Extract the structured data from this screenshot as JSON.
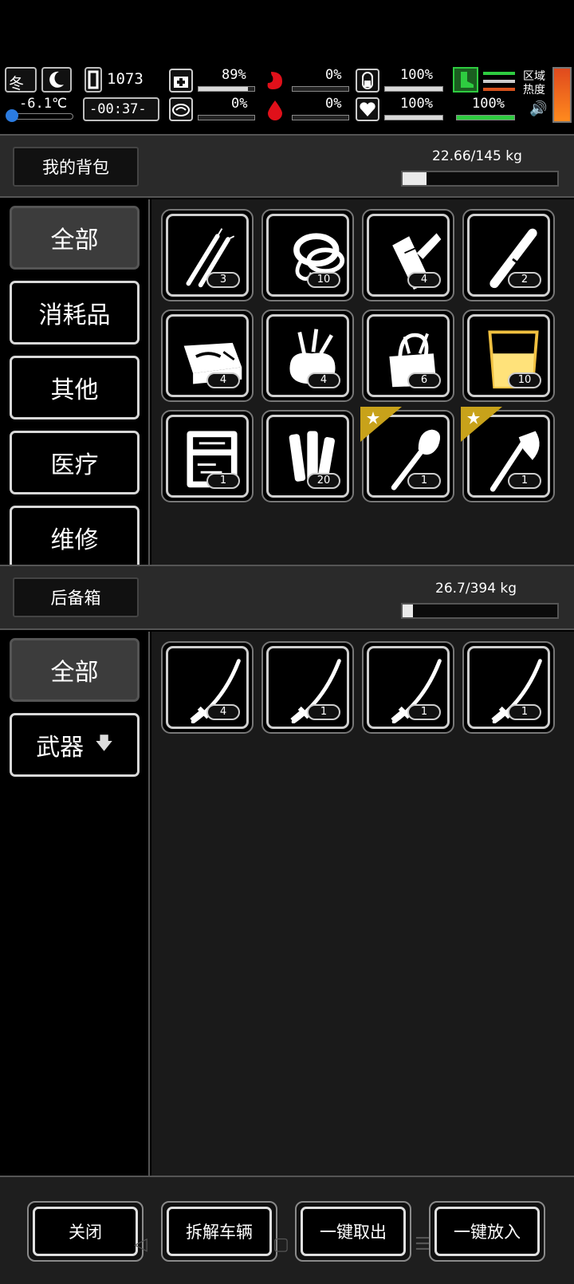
{
  "status": {
    "season": "冬",
    "temperature": "-6.1℃",
    "day_counter": "1073",
    "time": "-00:37-",
    "health_pct": "89%",
    "hunger_pct": "0%",
    "stamina_pct": "100%",
    "mood_pct": "0%",
    "thirst_pct": "0%",
    "heart_pct": "100%",
    "energy_pct": "100%",
    "zone_heat_label": "区域\n热度",
    "levels": {
      "health": 0.89,
      "hunger": 0.0,
      "stamina": 1.0,
      "mood": 0.0,
      "thirst": 0.0,
      "heart": 1.0,
      "energy": 1.0
    }
  },
  "backpack": {
    "title": "我的背包",
    "weight": "22.66/145 kg",
    "weight_fraction": 0.156,
    "categories": [
      {
        "label": "全部",
        "active": true
      },
      {
        "label": "消耗品"
      },
      {
        "label": "其他"
      },
      {
        "label": "医疗"
      },
      {
        "label": "维修"
      }
    ],
    "items": [
      {
        "icon": "picks-icon",
        "count": "3"
      },
      {
        "icon": "rope-icon",
        "count": "10"
      },
      {
        "icon": "splint-icon",
        "count": "4"
      },
      {
        "icon": "pipe-icon",
        "count": "2"
      },
      {
        "icon": "toolbox-open-icon",
        "count": "4"
      },
      {
        "icon": "tool-sack-icon",
        "count": "4"
      },
      {
        "icon": "tool-bag-icon",
        "count": "6"
      },
      {
        "icon": "cup-icon",
        "count": "10"
      },
      {
        "icon": "tool-case-icon",
        "count": "1"
      },
      {
        "icon": "tubes-icon",
        "count": "20"
      },
      {
        "icon": "shovel-icon",
        "count": "1",
        "starred": true
      },
      {
        "icon": "axe-icon",
        "count": "1",
        "starred": true
      }
    ]
  },
  "trunk": {
    "title": "后备箱",
    "weight": "26.7/394 kg",
    "weight_fraction": 0.068,
    "categories": [
      {
        "label": "全部",
        "active": true
      },
      {
        "label": "武器",
        "arrow": "🡇"
      }
    ],
    "items": [
      {
        "icon": "katana-icon",
        "count": "4"
      },
      {
        "icon": "katana-icon",
        "count": "1"
      },
      {
        "icon": "katana-icon",
        "count": "1"
      },
      {
        "icon": "katana-icon",
        "count": "1"
      }
    ]
  },
  "buttons": {
    "close": "关闭",
    "dismantle": "拆解车辆",
    "take_all": "一键取出",
    "put_all": "一键放入"
  },
  "colors": {
    "star_badge": "#c8a21a",
    "heat_meter": "#d9531e",
    "energy_bar": "#2ecc40",
    "drop": "#e0101a"
  }
}
